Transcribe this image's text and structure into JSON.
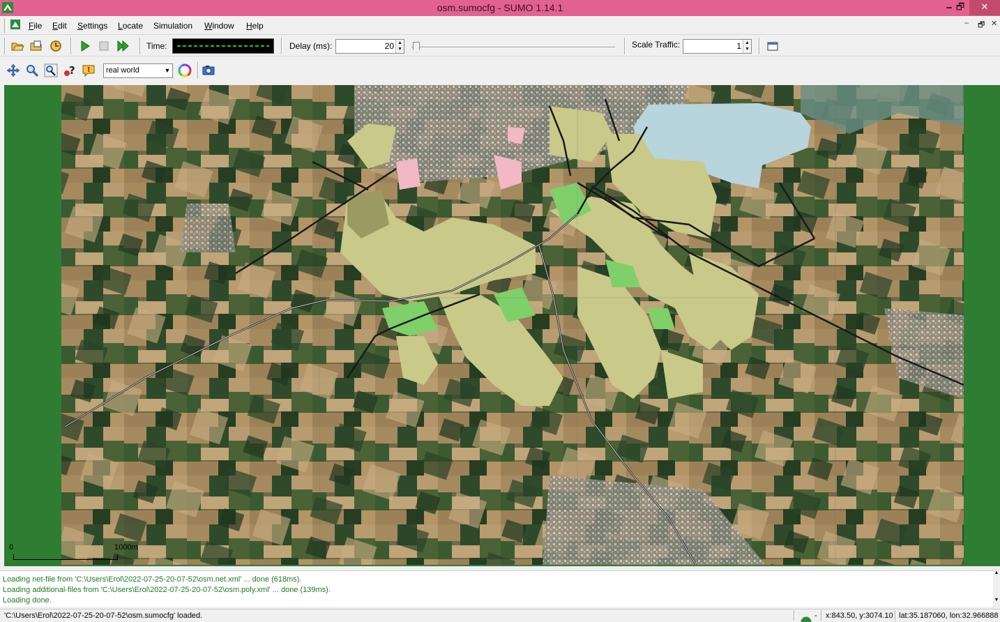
{
  "window": {
    "title": "osm.sumocfg - SUMO 1.14.1",
    "minimize": "🗕",
    "restore": "🗗",
    "close": "✕"
  },
  "menu": {
    "items": [
      {
        "mnemonic": "F",
        "rest": "ile"
      },
      {
        "mnemonic": "E",
        "rest": "dit"
      },
      {
        "mnemonic": "S",
        "rest": "ettings"
      },
      {
        "mnemonic": "L",
        "rest": "ocate"
      },
      {
        "mnemonic": "S",
        "rest": "imulation"
      },
      {
        "mnemonic": "W",
        "rest": "indow"
      },
      {
        "mnemonic": "H",
        "rest": "elp"
      }
    ],
    "mdi_minimize": "–",
    "mdi_restore": "🗗",
    "mdi_close": "✕"
  },
  "toolbar": {
    "time_label": "Time:",
    "delay_label": "Delay (ms):",
    "delay_value": "20",
    "scale_label": "Scale Traffic:",
    "scale_value": "1",
    "icons": [
      "open-icon",
      "reload-icon",
      "recent-icon",
      "run-icon",
      "stop-icon",
      "step-icon",
      "breakpoint-icon"
    ]
  },
  "view_toolbar": {
    "scheme_value": "real world",
    "icons": [
      "recenter-icon",
      "zoom-icon",
      "locate-icon",
      "query-icon",
      "message-icon",
      "color-wheel-icon",
      "screenshot-icon"
    ]
  },
  "map": {
    "scale_zero": "0",
    "scale_length": "1000m"
  },
  "messages": [
    "Loading net-file from 'C:\\Users\\Erol\\2022-07-25-20-07-52\\osm.net.xml' ... done (618ms).",
    "Loading additional-files from 'C:\\Users\\Erol\\2022-07-25-20-07-52\\osm.poly.xml' ... done (139ms).",
    "Loading done."
  ],
  "status": {
    "text": "'C:\\Users\\Erol\\2022-07-25-20-07-52\\osm.sumocfg' loaded.",
    "dash": "-",
    "xy": "x:843.50, y:3074.10",
    "latlon": "lat:35.187060, lon:32.966888"
  },
  "colors": {
    "titlebar": "#e2628f",
    "map_background": "#2e7d32",
    "message_text": "#1f7a1f",
    "landuse_farmland": "#c9c98a",
    "landuse_grass": "#7fcf6a",
    "water": "#b8d4dc"
  }
}
